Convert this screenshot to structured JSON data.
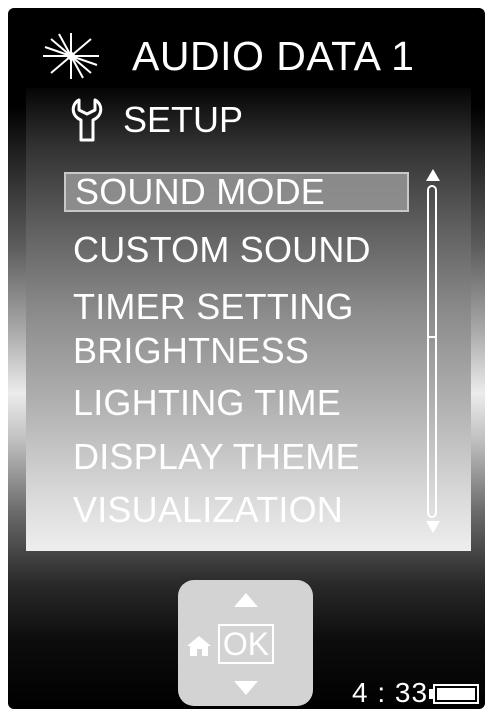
{
  "header": {
    "title": "AUDIO DATA 1",
    "icon": "sparkle-icon"
  },
  "setup": {
    "title": "SETUP",
    "icon": "wrench-icon"
  },
  "menu": {
    "selected_index": 0,
    "items": [
      {
        "label": "SOUND MODE"
      },
      {
        "label": "CUSTOM SOUND"
      },
      {
        "label": "TIMER SETTING"
      },
      {
        "label": "BRIGHTNESS"
      },
      {
        "label": "LIGHTING TIME"
      },
      {
        "label": "DISPLAY THEME"
      },
      {
        "label": "VISUALIZATION"
      }
    ]
  },
  "scroll": {
    "position_fraction": 0.0,
    "visible_fraction": 0.46
  },
  "nav": {
    "ok_label": "OK",
    "up_icon": "triangle-up-icon",
    "down_icon": "triangle-down-icon",
    "home_icon": "home-icon"
  },
  "status": {
    "time": "4 : 33",
    "battery_icon": "battery-icon",
    "battery_level": 1.0
  },
  "colors": {
    "text": "#ffffff",
    "highlight": "#969696",
    "pad": "#d3d3d3"
  }
}
